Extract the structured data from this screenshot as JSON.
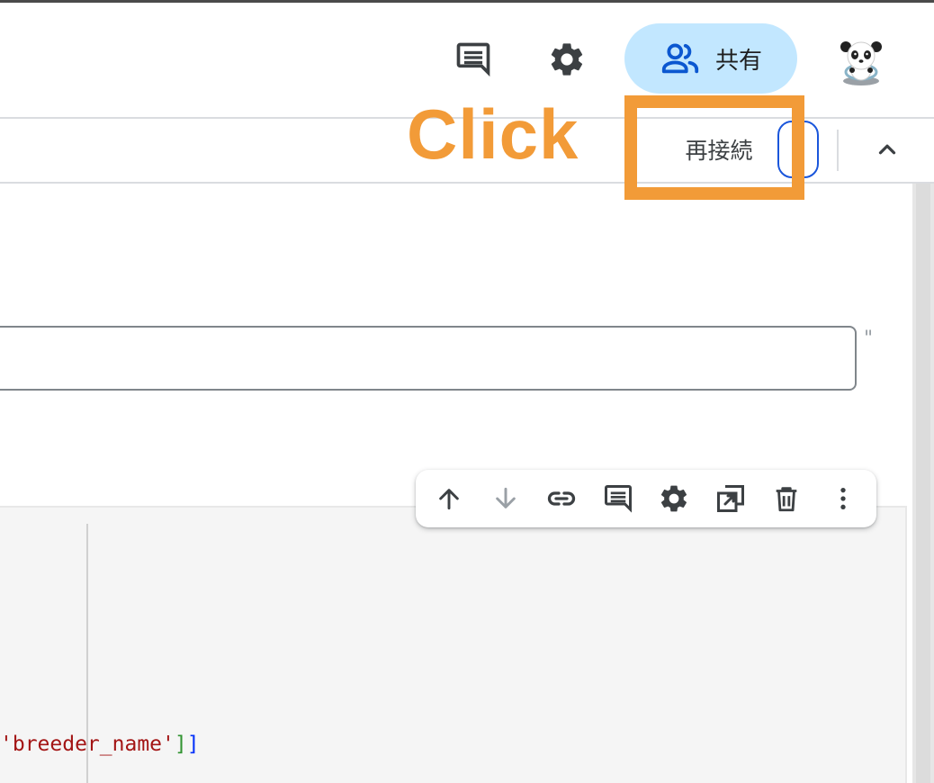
{
  "header": {
    "comments_icon": "comments-icon",
    "settings_icon": "gear-icon",
    "share": {
      "label": "共有",
      "icon": "people-icon"
    },
    "avatar": "panda-avatar"
  },
  "toolbar": {
    "reconnect_label": "再接続",
    "dropdown_icon": "chevron-down-icon",
    "collapse_icon": "chevron-up-icon"
  },
  "annotation": {
    "click_label": "Click",
    "color": "#f29b38"
  },
  "form": {
    "text_field_value": "",
    "trailing_quote": "\""
  },
  "cell_toolbar": {
    "items": [
      "arrow-up-icon",
      "arrow-down-icon",
      "link-icon",
      "comment-icon",
      "gear-icon",
      "mirror-cell-icon",
      "delete-icon",
      "more-vert-icon"
    ]
  },
  "code": {
    "str": "'breeder_name'",
    "bracket1": "]",
    "bracket2": "]",
    "colors": {
      "string": "#a31515",
      "bracket_inner": "#319331",
      "bracket_outer": "#0431fa"
    }
  },
  "colors": {
    "share_bg": "#c2e7ff",
    "focus_ring": "#1a56db",
    "cell_bg": "#f5f5f5"
  }
}
